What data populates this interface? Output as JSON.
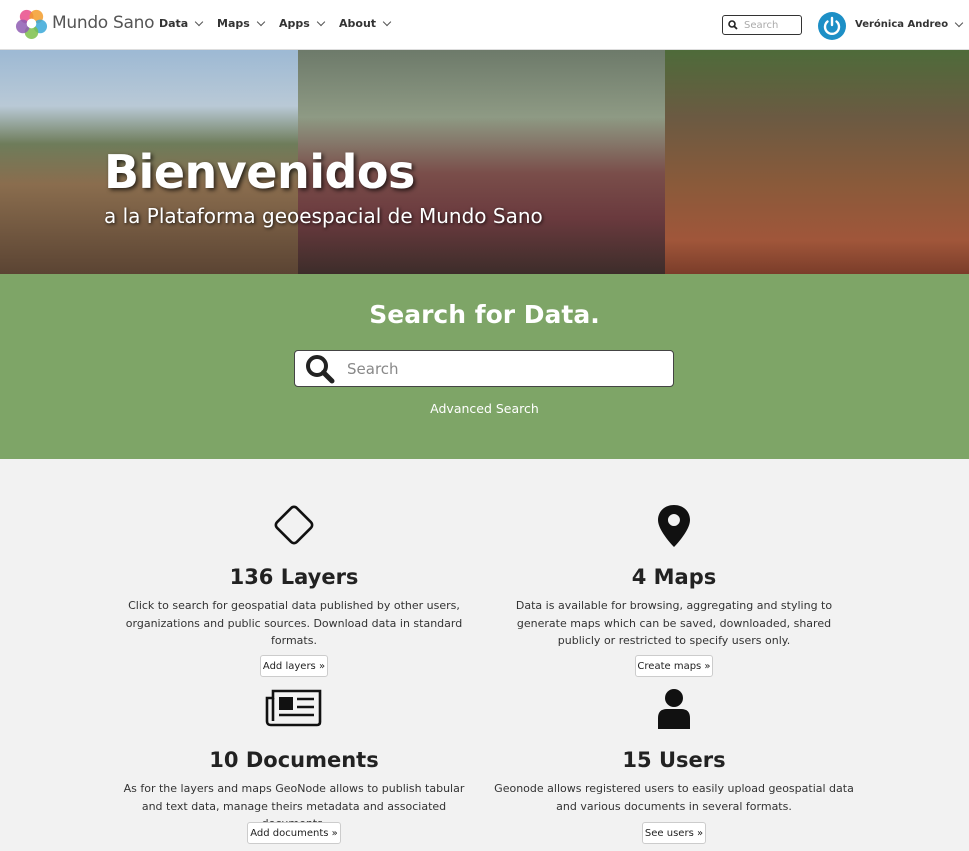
{
  "navbar": {
    "brand": "Mundo Sano",
    "menu": [
      {
        "label": "Data"
      },
      {
        "label": "Maps"
      },
      {
        "label": "Apps"
      },
      {
        "label": "About"
      }
    ],
    "search_placeholder": "Search",
    "user_name": "Verónica Andreo"
  },
  "hero": {
    "title": "Bienvenidos",
    "subtitle": "a la Plataforma geoespacial de Mundo Sano"
  },
  "search_section": {
    "title": "Search for Data.",
    "placeholder": "Search",
    "advanced_link": "Advanced Search",
    "background_color": "#7ea567"
  },
  "stats": [
    {
      "icon": "diamond-icon",
      "title": "136 Layers",
      "description": "Click to search for geospatial data published by other users, organizations and public sources. Download data in standard formats.",
      "button": "Add layers »"
    },
    {
      "icon": "map-marker-icon",
      "title": "4 Maps",
      "description": "Data is available for browsing, aggregating and styling to generate maps which can be saved, downloaded, shared publicly or restricted to specify users only.",
      "button": "Create maps »"
    },
    {
      "icon": "newspaper-icon",
      "title": "10 Documents",
      "description": "As for the layers and maps GeoNode allows to publish tabular and text data, manage theirs metadata and associated documents.",
      "button": "Add documents »"
    },
    {
      "icon": "user-icon",
      "title": "15 Users",
      "description": "Geonode allows registered users to easily upload geospatial data and various documents in several formats.",
      "button": "See users »"
    }
  ]
}
